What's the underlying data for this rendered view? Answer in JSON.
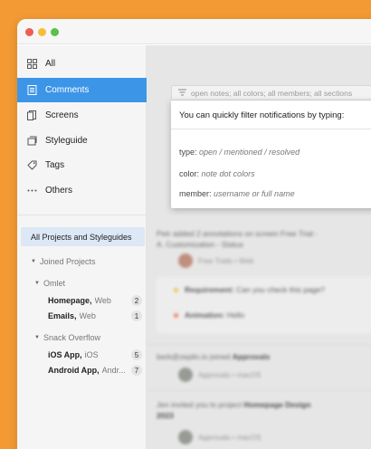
{
  "sidebar": {
    "nav": [
      {
        "label": "All",
        "icon": "grid-icon"
      },
      {
        "label": "Comments",
        "icon": "comment-list-icon"
      },
      {
        "label": "Screens",
        "icon": "screens-icon"
      },
      {
        "label": "Styleguide",
        "icon": "styleguide-icon"
      },
      {
        "label": "Tags",
        "icon": "tag-icon"
      },
      {
        "label": "Others",
        "icon": "more-icon"
      }
    ],
    "projects_button": "All Projects and Styleguides",
    "joined_projects": "Joined Projects",
    "groups": [
      {
        "name": "Omlet",
        "items": [
          {
            "name": "Homepage,",
            "platform": "Web",
            "count": "2"
          },
          {
            "name": "Emails,",
            "platform": "Web",
            "count": "1"
          }
        ]
      },
      {
        "name": "Snack Overflow",
        "items": [
          {
            "name": "iOS App,",
            "platform": "iOS",
            "count": "5"
          },
          {
            "name": "Android App,",
            "platform": "Andr...",
            "count": "7"
          }
        ]
      }
    ]
  },
  "filter": {
    "placeholder": "open notes; all colors; all members; all sections"
  },
  "popup": {
    "heading": "You can quickly filter notifications by typing:",
    "lines": [
      {
        "key": "type:",
        "hint": "open / mentioned / resolved"
      },
      {
        "key": "color:",
        "hint": "note dot colors"
      },
      {
        "key": "member:",
        "hint": "username or full name"
      }
    ]
  },
  "feed": {
    "item1_line1": "Petr added 2 annotations on screen Free Trial -",
    "item1_line2": "A. Customization - Status",
    "item1_meta": "Free Trails • Web",
    "note1_label": "Requirement:",
    "note1_text": "Can you check this page?",
    "note2_label": "Animation:",
    "note2_text": "Hello",
    "item2_user": "berk@zeplin.io joined",
    "item2_project": "Approvals",
    "item2_meta": "Approvals • macOS",
    "item3_text": "Jen invited you to project",
    "item3_project": "Homepage Design",
    "item3_line2": "2023",
    "item3_meta": "Approvals • macOS"
  },
  "colors": {
    "accent": "#3d95e8",
    "background": "#f39a34",
    "note_yellow": "#f5bd3b",
    "note_orange": "#f0733c"
  }
}
